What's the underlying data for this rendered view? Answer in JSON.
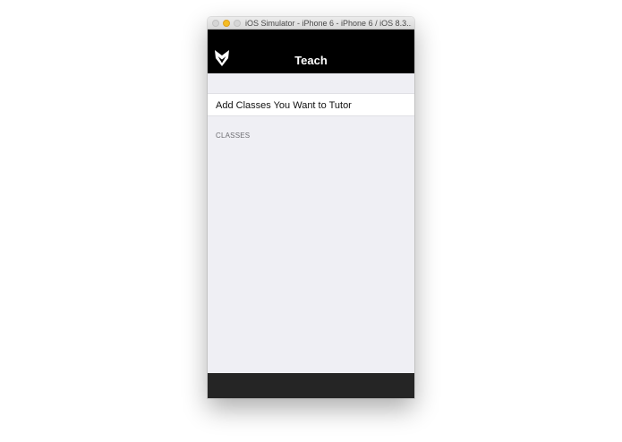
{
  "window": {
    "title": "iOS Simulator - iPhone 6 - iPhone 6 / iOS 8.3..."
  },
  "navbar": {
    "title": "Teach",
    "logo_icon": "fox-logo-icon",
    "background": "#000000"
  },
  "content": {
    "add_classes_label": "Add Classes You Want to Tutor",
    "section_header": "CLASSES",
    "background": "#efeff4"
  },
  "colors": {
    "traffic_minimize": "#f5bd22",
    "bottom_bar": "#252525"
  }
}
